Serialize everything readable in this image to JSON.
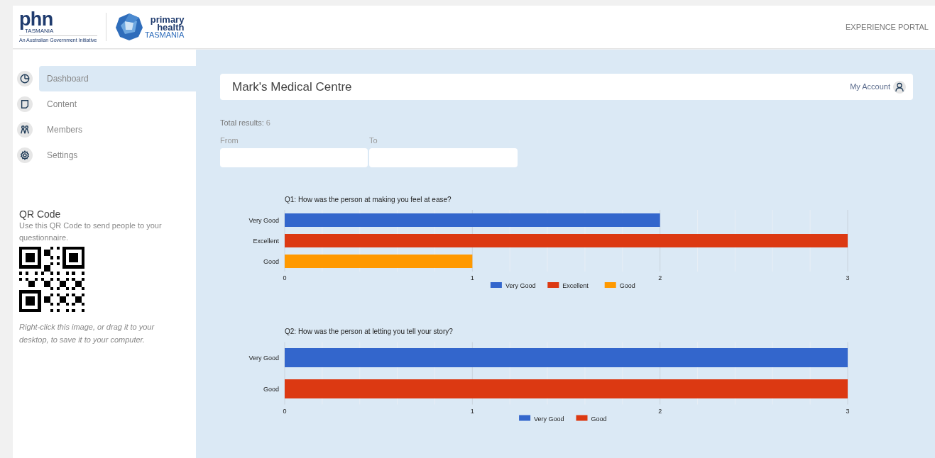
{
  "header": {
    "brand": {
      "phn": "phn",
      "phn_sub": "TASMANIA",
      "tagline": "An Australian Government Initiative",
      "name_line1": "primary",
      "name_line2": "health",
      "name_line3": "TASMANIA"
    },
    "portal": "EXPERIENCE PORTAL"
  },
  "sidebar": {
    "items": [
      {
        "label": "Dashboard",
        "kind": "pie",
        "selected": true
      },
      {
        "label": "Content",
        "kind": "page",
        "selected": false
      },
      {
        "label": "Members",
        "kind": "people",
        "selected": false
      },
      {
        "label": "Settings",
        "kind": "gear",
        "selected": false
      }
    ],
    "qr": {
      "title": "QR Code",
      "text": "Use this QR Code to send people to your questionnaire.",
      "hint": "Right-click this image, or drag it to your desktop, to save it to your computer."
    }
  },
  "main": {
    "title": "Mark's Medical Centre",
    "account": "My Account",
    "total_label": "Total results:",
    "total_value": "6",
    "from_label": "From",
    "to_label": "To",
    "charts": [
      {
        "chart_data": {
          "type": "bar",
          "orientation": "horizontal",
          "title": "Q1: How was the person at making you feel at ease?",
          "categories": [
            "Very Good",
            "Excellent",
            "Good"
          ],
          "legend": "bottom",
          "xlim": [
            0,
            3
          ],
          "xticks": [
            0,
            1,
            2,
            3
          ],
          "series": [
            {
              "name": "Very Good",
              "color": "#3366cc",
              "values": [
                2,
                null,
                null
              ]
            },
            {
              "name": "Excellent",
              "color": "#dc3912",
              "values": [
                null,
                3,
                null
              ]
            },
            {
              "name": "Good",
              "color": "#ff9900",
              "values": [
                null,
                null,
                1
              ]
            }
          ]
        }
      },
      {
        "chart_data": {
          "type": "bar",
          "orientation": "horizontal",
          "title": "Q2: How was the person at letting you tell your story?",
          "categories": [
            "Very Good",
            "Good"
          ],
          "legend": "bottom",
          "xlim": [
            0,
            3
          ],
          "xticks": [
            0,
            1,
            2,
            3
          ],
          "series": [
            {
              "name": "Very Good",
              "color": "#3366cc",
              "values": [
                3,
                null
              ]
            },
            {
              "name": "Good",
              "color": "#dc3912",
              "values": [
                null,
                3
              ]
            }
          ]
        }
      }
    ]
  }
}
